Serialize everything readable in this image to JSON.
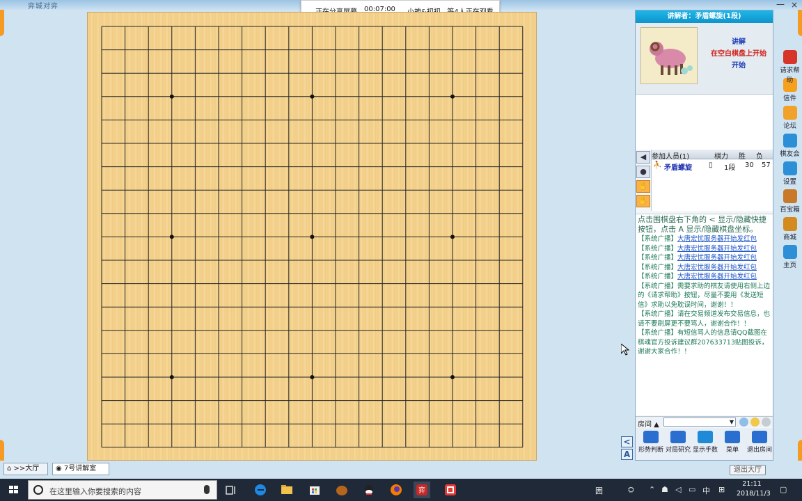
{
  "app": {
    "title": "弈城对弈",
    "minimize_label": "—",
    "close_label": "×"
  },
  "share_banner": {
    "status": "正在分享屏幕",
    "timer": "00:07:00",
    "viewers": "小神&初初...等4人正在观看"
  },
  "board": {
    "size": 19,
    "star_points": [
      [
        3,
        3
      ],
      [
        9,
        3
      ],
      [
        15,
        3
      ],
      [
        3,
        9
      ],
      [
        9,
        9
      ],
      [
        15,
        9
      ],
      [
        3,
        15
      ],
      [
        9,
        15
      ],
      [
        15,
        15
      ]
    ],
    "show_hide_button": "<",
    "coords_button": "A"
  },
  "lecture": {
    "lecturer_label": "讲解者：",
    "lecturer_name": "矛盾螺旋(1段)",
    "line1": "讲解",
    "line2": "在空白棋盘上开始",
    "line3": "开始",
    "avatar_icon": "sheep-avatar-icon"
  },
  "members": {
    "headers": {
      "name": "参加人员(1)",
      "rank": "棋力",
      "win": "胜",
      "loss": "负"
    },
    "rows": [
      {
        "name": "矛盾螺旋",
        "rank": "1段",
        "win": "30",
        "loss": "57"
      }
    ]
  },
  "side_icons": [
    "speaker-icon",
    "mic-icon",
    "hand-icon",
    "hand-mic-icon"
  ],
  "chat": {
    "hint": "点击围棋盘右下角的 < 显示/隐藏快捷按钮，点击 A 显示/隐藏棋盘坐标。",
    "messages": [
      {
        "tag": "【系统广播】",
        "text": "大唐宏忧服务器开始发红包",
        "link": true
      },
      {
        "tag": "【系统广播】",
        "text": "大唐宏忧服务器开始发红包",
        "link": true
      },
      {
        "tag": "【系统广播】",
        "text": "大唐宏忧服务器开始发红包",
        "link": true
      },
      {
        "tag": "【系统广播】",
        "text": "大唐宏忧服务器开始发红包",
        "link": true
      },
      {
        "tag": "【系统广播】",
        "text": "大唐宏忧服务器开始发红包",
        "link": true
      },
      {
        "tag": "【系统广播】",
        "text": "需要求助的棋友请使用右侧上边的《请求帮助》按钮，尽量不要用《发送短信》求助以免耽误时间，谢谢！！",
        "link": false
      },
      {
        "tag": "【系统广播】",
        "text": "请在交易频道发布交易信息，也请不要刷屏更不要骂人，谢谢合作！！",
        "link": false
      },
      {
        "tag": "【系统广播】",
        "text": "有短信骂人的信息请QQ截图在棋魂官方投诉建议群207633713贴图投诉，谢谢大家合作！！",
        "link": false
      }
    ]
  },
  "room_bar": {
    "label": "房间 ▲",
    "select_arrow": "▼"
  },
  "tools": [
    {
      "label": "形势判断",
      "icon": "chart-bars-icon",
      "color": "#2a6fcf"
    },
    {
      "label": "对局研究",
      "icon": "board-grid-icon",
      "color": "#2a6fcf"
    },
    {
      "label": "显示手数",
      "icon": "number-8-icon",
      "color": "#1f8ad6"
    },
    {
      "label": "菜单",
      "icon": "menu-icon",
      "color": "#2a6fcf"
    },
    {
      "label": "退出房间",
      "icon": "exit-door-icon",
      "color": "#2a6fcf"
    }
  ],
  "features": [
    {
      "label": "请求帮助",
      "icon": "help-icon",
      "color": "#d8352a"
    },
    {
      "label": "信件",
      "icon": "mail-icon",
      "color": "#f5a11e"
    },
    {
      "label": "论坛",
      "icon": "forum-icon",
      "color": "#f0a22a"
    },
    {
      "label": "棋友会",
      "icon": "club-icon",
      "color": "#2d8fd6"
    },
    {
      "label": "设置",
      "icon": "gear-icon",
      "color": "#2d8fd6"
    },
    {
      "label": "百宝箱",
      "icon": "treasure-icon",
      "color": "#c87a2a"
    },
    {
      "label": "商城",
      "icon": "shop-icon",
      "color": "#d48a1e"
    },
    {
      "label": "主页",
      "icon": "home-icon",
      "color": "#2d8fd6"
    }
  ],
  "tabs": [
    {
      "label": ">>大厅",
      "icon": "house-icon"
    },
    {
      "label": "7号讲解室",
      "icon": "room-icon"
    }
  ],
  "exit_hall": "退出大厅",
  "taskbar": {
    "search_placeholder": "在这里输入你要搜索的内容",
    "time": "21:11",
    "date": "2018/11/3",
    "ime_label": "中",
    "ime_icon": "囲"
  }
}
